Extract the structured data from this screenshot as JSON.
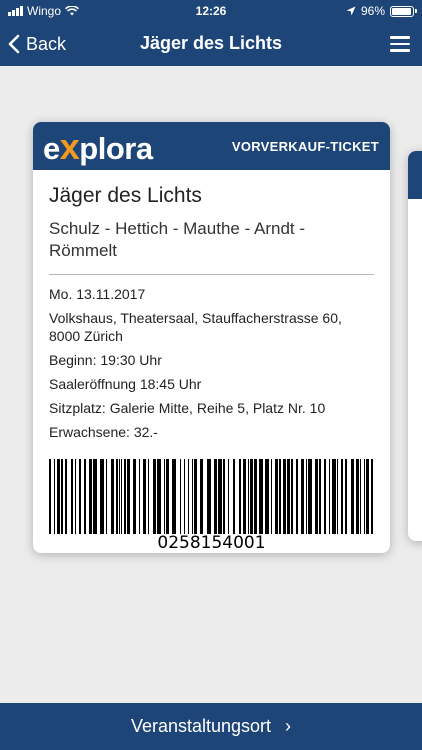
{
  "status_bar": {
    "carrier": "Wingo",
    "time": "12:26",
    "battery_percent": "96%",
    "battery_level": 0.96
  },
  "navbar": {
    "back_label": "Back",
    "title": "Jäger des Lichts",
    "menu_icon": "hamburger-menu-icon"
  },
  "ticket": {
    "logo": {
      "prefix": "e",
      "x": "x",
      "suffix": "plora"
    },
    "type": "VORVERKAUF-TICKET",
    "title": "Jäger des Lichts",
    "artists": "Schulz - Hettich - Mauthe - Arndt - Römmelt",
    "date": "Mo. 13.11.2017",
    "venue": "Volkshaus, Theatersaal, Stauffacherstrasse 60, 8000 Zürich",
    "start": "Beginn: 19:30 Uhr",
    "doors": "Saaleröffnung 18:45 Uhr",
    "seat": "Sitzplatz: Galerie Mitte, Reihe 5, Platz Nr. 10",
    "price": "Erwachsene: 32.-",
    "barcode_number": "0258154001"
  },
  "bottom_bar": {
    "label": "Veranstaltungsort",
    "chevron": "›"
  },
  "colors": {
    "brand_blue": "#1d4578",
    "logo_x_orange": "#f29a1f",
    "background": "#ececec"
  }
}
